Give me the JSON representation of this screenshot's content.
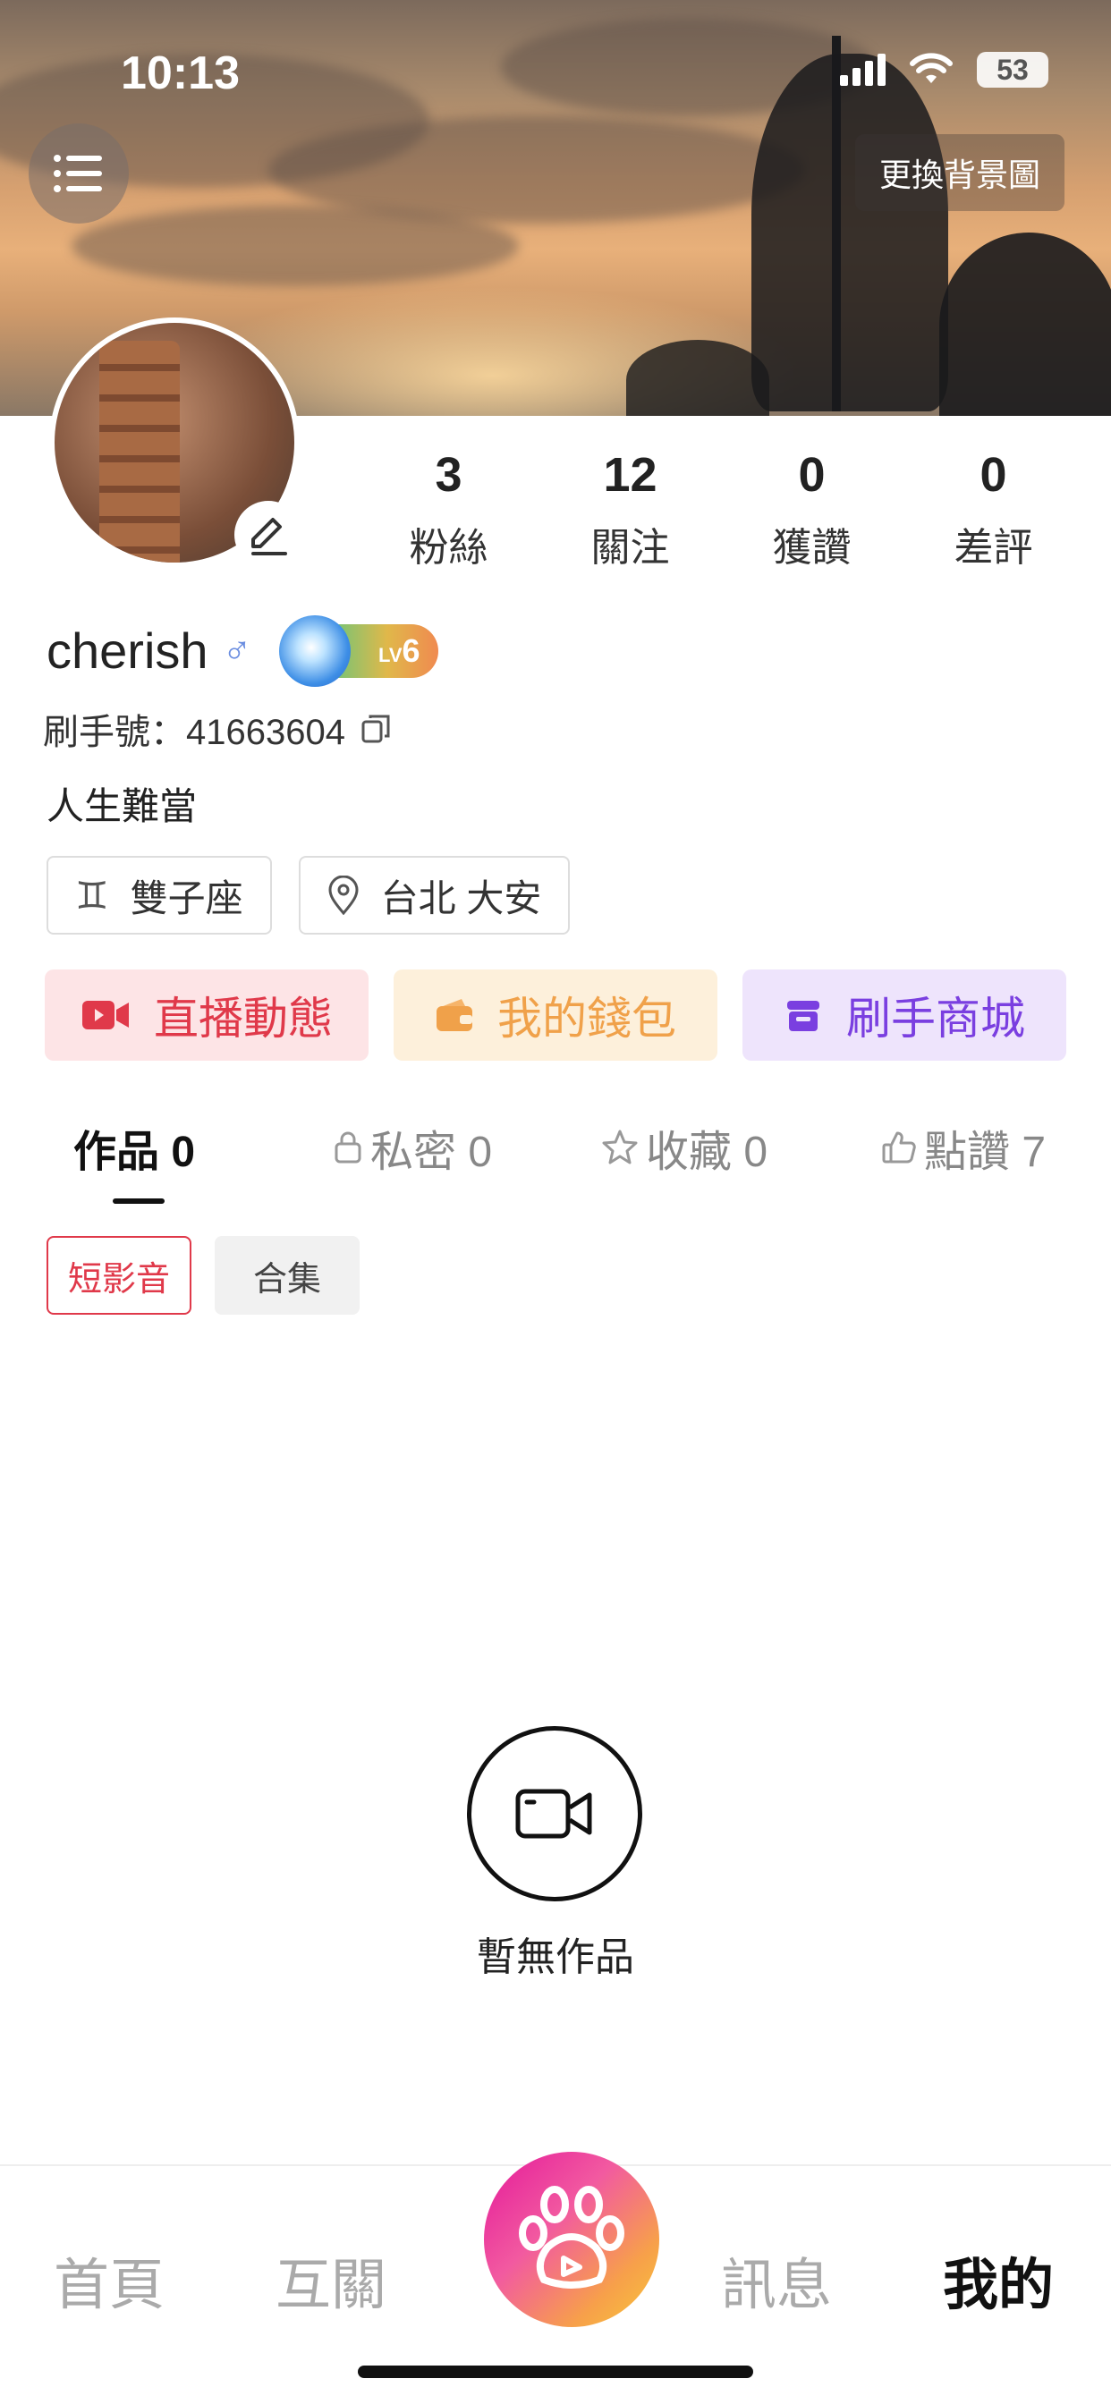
{
  "status": {
    "time": "10:13",
    "battery": "53"
  },
  "header": {
    "change_background": "更換背景圖"
  },
  "profile": {
    "username": "cherish",
    "gender_symbol": "♂",
    "level": "6",
    "level_prefix": "LV",
    "id_label": "刷手號：41663604",
    "bio": "人生難當",
    "zodiac": "雙子座",
    "zodiac_symbol": "♊",
    "location": "台北 大安"
  },
  "stats": [
    {
      "value": "3",
      "label": "粉絲"
    },
    {
      "value": "12",
      "label": "關注"
    },
    {
      "value": "0",
      "label": "獲讚"
    },
    {
      "value": "0",
      "label": "差評"
    }
  ],
  "actions": {
    "live": "直播動態",
    "wallet": "我的錢包",
    "shop": "刷手商城"
  },
  "tabs": {
    "works": "作品 0",
    "private": "私密 0",
    "favorites": "收藏 0",
    "likes": "點讚 7"
  },
  "sub_tabs": {
    "short_video": "短影音",
    "collection": "合集"
  },
  "empty": {
    "text": "暫無作品"
  },
  "nav": {
    "home": "首頁",
    "mutual": "互關",
    "messages": "訊息",
    "mine": "我的"
  },
  "colors": {
    "accent_red": "#e0394a",
    "wallet_orange": "#f0a14a",
    "shop_purple": "#7a3fe0"
  }
}
